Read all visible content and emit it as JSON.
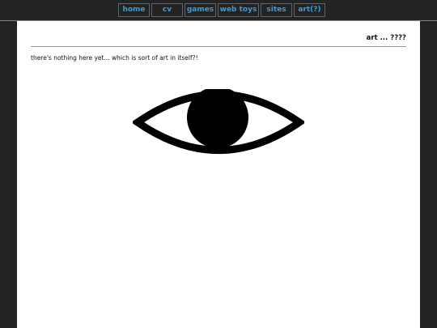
{
  "nav": {
    "items": [
      {
        "label": "home"
      },
      {
        "label": "cv"
      },
      {
        "label": "games"
      },
      {
        "label": "web toys"
      },
      {
        "label": "sites"
      },
      {
        "label": "art(?)"
      }
    ]
  },
  "main": {
    "title": "art ... ????",
    "intro": "there's nothing here yet... which is sort of art in itself?!",
    "illustration_icon": "eye-icon"
  },
  "colors": {
    "background": "#232323",
    "accent": "#3a9bd8",
    "page": "#ffffff",
    "text": "#111111"
  }
}
